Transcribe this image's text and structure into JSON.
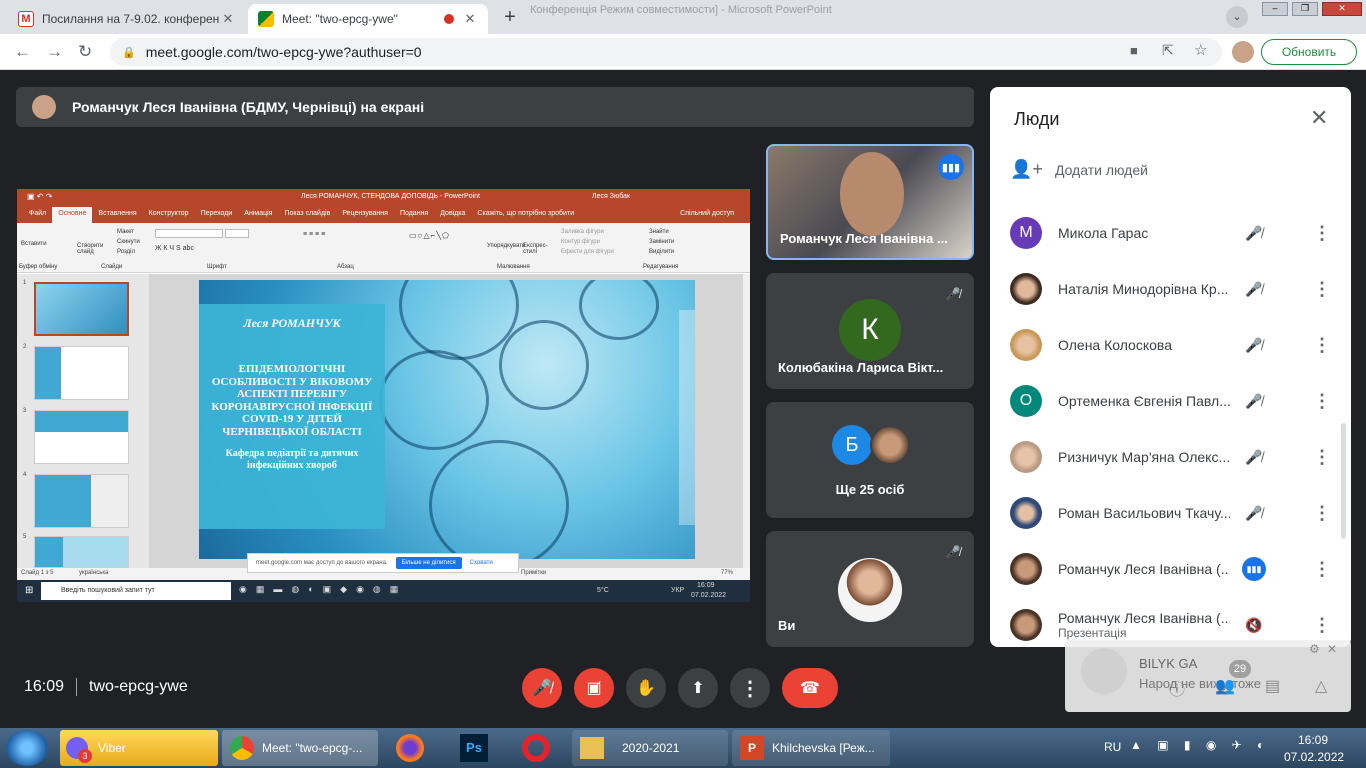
{
  "browser": {
    "tabs": [
      {
        "title": "Посилання на 7-9.02. конферен",
        "close": "✕"
      },
      {
        "title": "Meet: \"two-epcg-ywe\"",
        "close": "✕"
      }
    ],
    "new_tab": "+",
    "url": "meet.google.com/two-epcg-ywe?authuser=0",
    "update_label": "Обновить",
    "window_title": "Конференція Режим совместимости] - Microsoft PowerPoint"
  },
  "presentation_bar": {
    "text": "Романчук Леся Іванівна (БДМУ, Чернівці) на екрані"
  },
  "shared_screen": {
    "ppt_title": "Леся РОМАНЧУК, СТЕНДОВА ДОПОВІДЬ - PowerPoint",
    "ppt_user": "Леся Зюбак",
    "ribbon_tabs": [
      "Файл",
      "Основне",
      "Вставлення",
      "Конструктор",
      "Переходи",
      "Анімація",
      "Показ слайдів",
      "Рецензування",
      "Подання",
      "Довідка"
    ],
    "tell_me": "Скажіть, що потрібно зробити",
    "share_label": "Спільний доступ",
    "groups": [
      "Буфер обміну",
      "Слайди",
      "Шрифт",
      "Абзац",
      "Малювання",
      "Редагування"
    ],
    "ribbon_items": {
      "paste": "Вставити",
      "new_slide": "Створити слайд",
      "layout": "Макет",
      "reset": "Скинути",
      "section": "Розділ",
      "arrange": "Упорядкувати",
      "quick_styles": "Експрес-стилі",
      "fill": "Заливка фігури",
      "outline": "Контур фігури",
      "effects": "Ефекти для фігури",
      "find": "Знайти",
      "replace": "Замінити",
      "select": "Виділити"
    },
    "thumb_numbers": [
      "1",
      "2",
      "3",
      "4",
      "5"
    ],
    "slide": {
      "author": "Леся РОМАНЧУК",
      "title": "ЕПІДЕМІОЛОГІЧНІ ОСОБЛИВОСТІ У ВІКОВОМУ АСПЕКТІ ПЕРЕБІГУ КОРОНАВІРУСНОЇ ІНФЕКЦІЇ COVID-19 У ДІТЕЙ ЧЕРНІВЕЦЬКОЇ ОБЛАСТІ",
      "department": "Кафедра педіатрії та дитячих інфекційних хвороб"
    },
    "status_left": "Слайд 1 з 5",
    "status_lang": "українська",
    "status_notes": "Примітки",
    "zoom": "77%",
    "share_notice": "meet.google.com має доступ до вашого екрана.",
    "stop_sharing": "Більше не ділитися",
    "hide": "Сховати",
    "win_search": "Введіть пошуковий запит тут",
    "win_temp": "5°C",
    "win_lang": "УКР",
    "win_time": "16:09",
    "win_date": "07.02.2022"
  },
  "tiles": [
    {
      "name": "Романчук Леся Іванівна ..."
    },
    {
      "initial": "К",
      "name": "Колюбакіна Лариса Вікт..."
    },
    {
      "initial": "Б",
      "name": "Ще 25 осіб"
    },
    {
      "name": "Ви"
    }
  ],
  "people_panel": {
    "title": "Люди",
    "add_people": "Додати людей",
    "people": [
      {
        "initial": "М",
        "name": "Микола Гарас",
        "color": "#673ab7"
      },
      {
        "name": "Наталія Минодорівна Кр..."
      },
      {
        "name": "Олена Колоскова"
      },
      {
        "initial": "О",
        "name": "Ортеменка Євгенія Павл...",
        "color": "#00897b"
      },
      {
        "name": "Ризничук Мар'яна Олекс..."
      },
      {
        "name": "Роман Васильович Ткачу..."
      },
      {
        "name": "Романчук Леся Іванівна (..."
      },
      {
        "name": "Романчук Леся Іванівна (...",
        "subtitle": "Презентація"
      }
    ]
  },
  "bottom_bar": {
    "time": "16:09",
    "meeting_code": "two-epcg-ywe"
  },
  "toast": {
    "name": "BILYK GA",
    "message": "Народ не вижу тоже",
    "count": "29"
  },
  "windows_taskbar": {
    "items": [
      {
        "label": "Viber",
        "badge": "3"
      },
      {
        "label": "Meet: \"two-epcg-..."
      },
      {
        "label": "2020-2021"
      },
      {
        "label": "Khilchevska [Реж..."
      }
    ],
    "lang": "RU",
    "time": "16:09",
    "date": "07.02.2022"
  }
}
